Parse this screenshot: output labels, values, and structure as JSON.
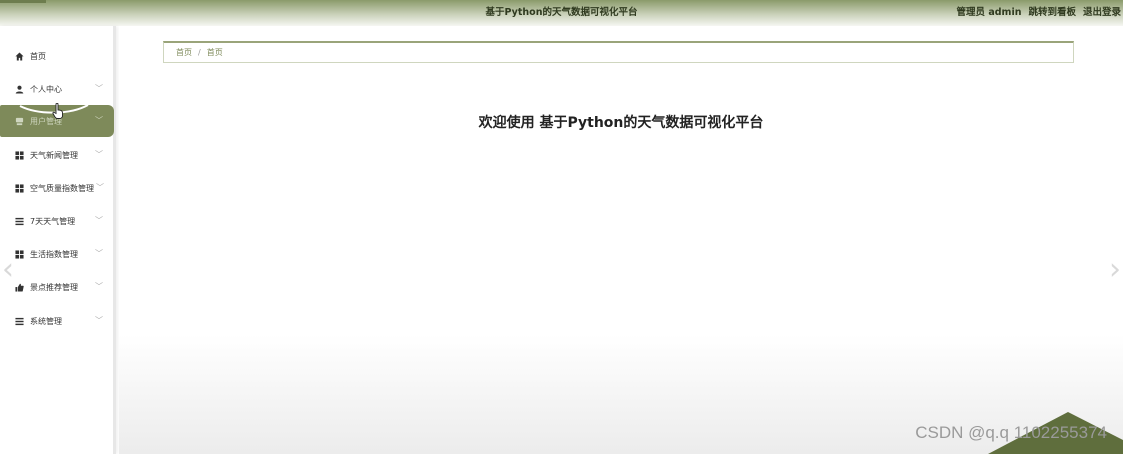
{
  "header": {
    "title": "基于Python的天气数据可视化平台",
    "admin_label": "管理员 admin",
    "dashboard_link": "跳转到看板",
    "logout_link": "退出登录"
  },
  "sidebar": {
    "items": [
      {
        "label": "首页",
        "icon": "home-icon",
        "has_submenu": false,
        "active": false
      },
      {
        "label": "个人中心",
        "icon": "user-icon",
        "has_submenu": true,
        "active": false
      },
      {
        "label": "用户管理",
        "icon": "users-icon",
        "has_submenu": true,
        "active": true
      },
      {
        "label": "天气新闻管理",
        "icon": "grid-icon",
        "has_submenu": true,
        "active": false
      },
      {
        "label": "空气质量指数管理",
        "icon": "grid-icon",
        "has_submenu": true,
        "active": false
      },
      {
        "label": "7天天气管理",
        "icon": "list-icon",
        "has_submenu": true,
        "active": false
      },
      {
        "label": "生活指数管理",
        "icon": "grid-icon",
        "has_submenu": true,
        "active": false
      },
      {
        "label": "景点推荐管理",
        "icon": "thumbs-up-icon",
        "has_submenu": true,
        "active": false
      },
      {
        "label": "系统管理",
        "icon": "list-icon",
        "has_submenu": true,
        "active": false
      }
    ]
  },
  "breadcrumb": {
    "items": [
      "首页",
      "首页"
    ],
    "separator": "/"
  },
  "main": {
    "welcome": "欢迎使用 基于Python的天气数据可视化平台"
  },
  "watermark": "CSDN @q.q 1102255374",
  "colors": {
    "accent": "#7e8a5a",
    "header_top": "#8a9a6a"
  }
}
